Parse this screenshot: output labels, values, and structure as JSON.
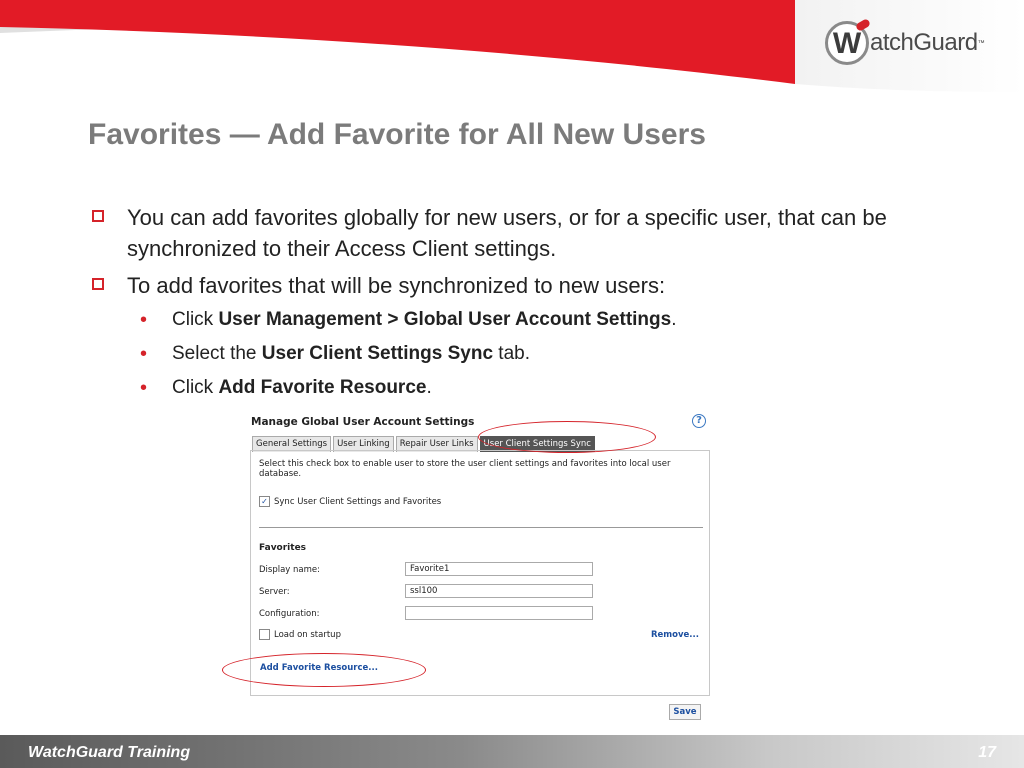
{
  "colors": {
    "accent": "#d5232a",
    "title": "#7b7b7b",
    "link": "#1c4fa0"
  },
  "logo": {
    "text": "atchGuard",
    "tm": "™",
    "mark": "W"
  },
  "slide": {
    "title": "Favorites — Add Favorite for All New Users",
    "bullets": [
      "You can add favorites globally for new users, or for a specific user, that can be synchronized to their Access Client settings.",
      "To add favorites that will be synchronized to new users:"
    ],
    "steps": [
      {
        "pre": "Click ",
        "bold": "User Management > Global User Account Settings",
        "post": "."
      },
      {
        "pre": "Select the ",
        "bold": "User Client Settings Sync",
        "post": " tab."
      },
      {
        "pre": "Click ",
        "bold": "Add Favorite Resource",
        "post": "."
      }
    ]
  },
  "screenshot": {
    "title": "Manage Global User Account Settings",
    "help_icon": "?",
    "tabs": [
      "General Settings",
      "User Linking",
      "Repair User Links",
      "User Client Settings Sync"
    ],
    "active_tab": "User Client Settings Sync",
    "description": "Select this check box to enable user to store the user client settings and favorites into local user database.",
    "sync_checkbox": {
      "label": "Sync User Client Settings and Favorites",
      "checked": true
    },
    "favorites_heading": "Favorites",
    "fields": {
      "display_name": {
        "label": "Display name:",
        "value": "Favorite1"
      },
      "server": {
        "label": "Server:",
        "value": "ssl100"
      },
      "configuration": {
        "label": "Configuration:",
        "value": ""
      }
    },
    "load_on_startup": {
      "label": "Load on startup",
      "checked": false
    },
    "remove_link": "Remove...",
    "add_link": "Add Favorite Resource...",
    "save_button": "Save"
  },
  "footer": {
    "left": "WatchGuard Training",
    "page": "17"
  }
}
